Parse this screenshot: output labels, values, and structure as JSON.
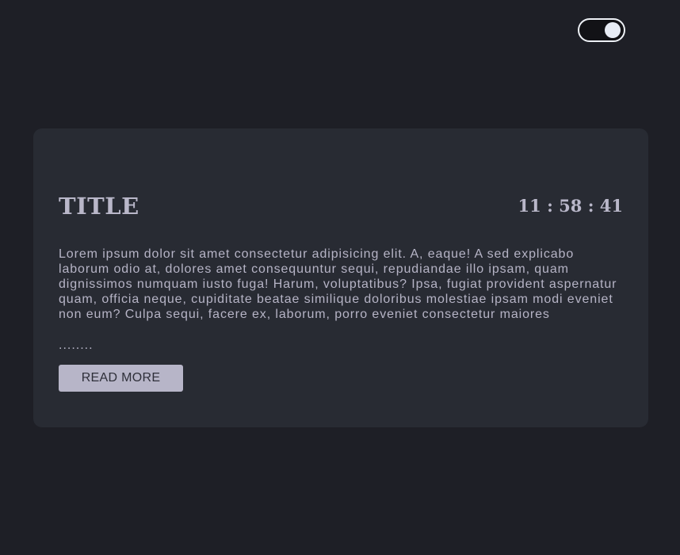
{
  "theme_toggle": {
    "state": "on"
  },
  "card": {
    "title": "TITLE",
    "clock": {
      "hours": "11",
      "separator": " : ",
      "minutes": "58",
      "seconds": "41"
    },
    "body": "Lorem ipsum dolor sit amet consectetur adipisicing elit. A, eaque! A sed explicabo laborum odio at, dolores amet consequuntur sequi, repudiandae illo ipsam, quam dignissimos numquam iusto fuga! Harum, voluptatibus? Ipsa, fugiat provident aspernatur quam, officia neque, cupiditate beatae similique doloribus molestiae ipsam modi eveniet non eum? Culpa sequi, facere ex, laborum, porro eveniet consectetur maiores",
    "ellipsis": "........",
    "read_more_label": "READ MORE"
  },
  "colors": {
    "page_background": "#1e1f26",
    "card_background": "#282b33",
    "text": "#b9b7c9",
    "button_background": "#b7b5c8",
    "button_text": "#2e2f39",
    "toggle_border": "#eef1f6"
  }
}
